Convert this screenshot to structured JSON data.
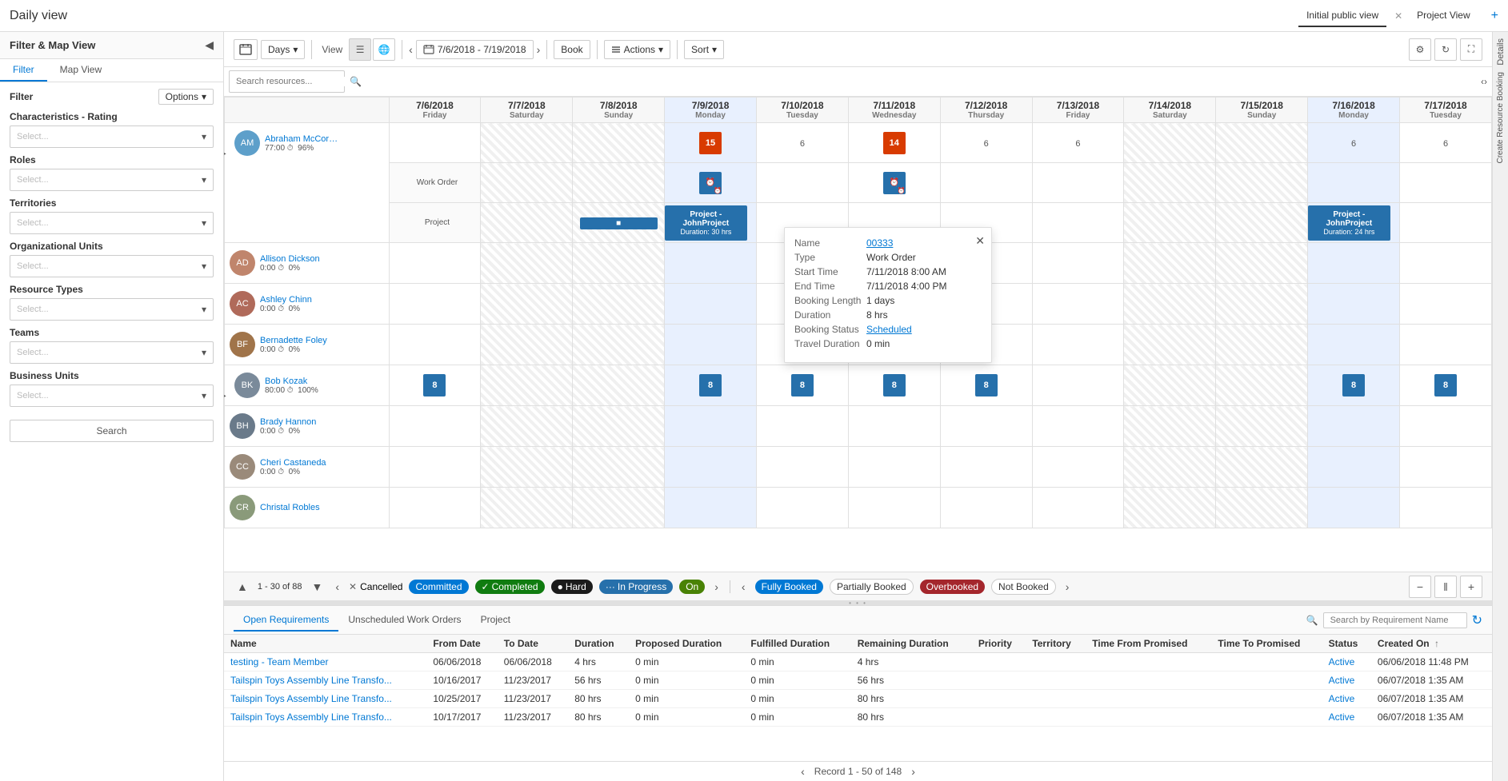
{
  "app": {
    "title": "Daily view",
    "tabs": [
      {
        "label": "Initial public view",
        "active": true
      },
      {
        "label": "Project View",
        "active": false
      }
    ]
  },
  "sidebar": {
    "title": "Filter & Map View",
    "tabs": [
      "Filter",
      "Map View"
    ],
    "active_tab": "Filter",
    "filter_label": "Filter",
    "options_btn": "Options",
    "sections": [
      {
        "label": "Characteristics - Rating"
      },
      {
        "label": "Roles"
      },
      {
        "label": "Territories"
      },
      {
        "label": "Organizational Units"
      },
      {
        "label": "Resource Types"
      },
      {
        "label": "Teams"
      },
      {
        "label": "Business Units"
      }
    ],
    "search_btn": "Search"
  },
  "toolbar": {
    "days_btn": "Days",
    "view_label": "View",
    "book_btn": "Book",
    "actions_btn": "Actions",
    "sort_btn": "Sort",
    "date_range": "7/6/2018 - 7/19/2018"
  },
  "schedule": {
    "search_placeholder": "Search resources...",
    "dates": [
      {
        "num": "7/6/2018",
        "day": "Friday"
      },
      {
        "num": "7/7/2018",
        "day": "Saturday"
      },
      {
        "num": "7/8/2018",
        "day": "Sunday"
      },
      {
        "num": "7/9/2018",
        "day": "Monday"
      },
      {
        "num": "7/10/2018",
        "day": "Tuesday"
      },
      {
        "num": "7/11/2018",
        "day": "Wednesday"
      },
      {
        "num": "7/12/2018",
        "day": "Thursday"
      },
      {
        "num": "7/13/2018",
        "day": "Friday"
      },
      {
        "num": "7/14/2018",
        "day": "Saturday"
      },
      {
        "num": "7/15/2018",
        "day": "Sunday"
      },
      {
        "num": "7/16/2018",
        "day": "Monday"
      },
      {
        "num": "7/17/2018",
        "day": "Tuesday"
      }
    ],
    "resources": [
      {
        "name": "Abraham McCormi...",
        "stats": "77:00 ⏱ 96%",
        "color": "#5d9fca",
        "initials": "AM",
        "rows": [
          "Work Order",
          "Project"
        ]
      },
      {
        "name": "Allison Dickson",
        "stats": "0:00 ⏱ 0%",
        "color": "#c0856c",
        "initials": "AD"
      },
      {
        "name": "Ashley Chinn",
        "stats": "0:00 ⏱ 0%",
        "color": "#b06a5a",
        "initials": "AC"
      },
      {
        "name": "Bernadette Foley",
        "stats": "0:00 ⏱ 0%",
        "color": "#a0744a",
        "initials": "BF"
      },
      {
        "name": "Bob Kozak",
        "stats": "80:00 ⏱ 100%",
        "color": "#7a8a9a",
        "initials": "BK"
      },
      {
        "name": "Brady Hannon",
        "stats": "0:00 ⏱ 0%",
        "color": "#6a7a8a",
        "initials": "BH"
      },
      {
        "name": "Cheri Castaneda",
        "stats": "0:00 ⏱ 0%",
        "color": "#9a8a7a",
        "initials": "CC"
      },
      {
        "name": "Christal Robles",
        "stats": "",
        "color": "#8a9a7a",
        "initials": "CR"
      }
    ]
  },
  "tooltip": {
    "name": "00333",
    "name_link": "00333",
    "type": "Work Order",
    "start_time": "7/11/2018 8:00 AM",
    "end_time": "7/11/2018 4:00 PM",
    "booking_length": "1 days",
    "duration": "8 hrs",
    "booking_status": "Scheduled",
    "travel_duration": "0 min"
  },
  "bottom_nav": {
    "page_info": "1 - 30 of 88",
    "legend": [
      {
        "label": "Cancelled",
        "type": "x"
      },
      {
        "label": "Committed",
        "type": "square",
        "color": "#0078d4"
      },
      {
        "label": "Completed",
        "type": "check",
        "color": "#107c10"
      },
      {
        "label": "Hard",
        "type": "dot",
        "color": "#1b1b1b"
      },
      {
        "label": "In Progress",
        "type": "square",
        "color": "#2670ab"
      },
      {
        "label": "On",
        "type": "square",
        "color": "#498205"
      }
    ],
    "booking_legend": [
      {
        "label": "Fully Booked",
        "color": "#0078d4"
      },
      {
        "label": "Partially Booked",
        "color": "#fff",
        "border": "#ccc"
      },
      {
        "label": "Overbooked",
        "color": "#a4262c"
      },
      {
        "label": "Not Booked",
        "color": "#fff",
        "border": "#ccc"
      }
    ]
  },
  "bottom_panel": {
    "tabs": [
      "Open Requirements",
      "Unscheduled Work Orders",
      "Project"
    ],
    "active_tab": "Open Requirements",
    "search_placeholder": "Search by Requirement Name",
    "columns": [
      "Name",
      "From Date",
      "To Date",
      "Duration",
      "Proposed Duration",
      "Fulfilled Duration",
      "Remaining Duration",
      "Priority",
      "Territory",
      "Time From Promised",
      "Time To Promised",
      "Status",
      "Created On"
    ],
    "rows": [
      {
        "name": "testing - Team Member",
        "from_date": "06/06/2018",
        "to_date": "06/06/2018",
        "duration": "4 hrs",
        "proposed": "0 min",
        "fulfilled": "0 min",
        "remaining": "4 hrs",
        "priority": "",
        "territory": "",
        "time_from": "",
        "time_to": "",
        "status": "Active",
        "created_on": "06/06/2018 11:48 PM"
      },
      {
        "name": "Tailspin Toys Assembly Line Transfo...",
        "from_date": "10/16/2017",
        "to_date": "11/23/2017",
        "duration": "56 hrs",
        "proposed": "0 min",
        "fulfilled": "0 min",
        "remaining": "56 hrs",
        "priority": "",
        "territory": "",
        "time_from": "",
        "time_to": "",
        "status": "Active",
        "created_on": "06/07/2018 1:35 AM"
      },
      {
        "name": "Tailspin Toys Assembly Line Transfo...",
        "from_date": "10/25/2017",
        "to_date": "11/23/2017",
        "duration": "80 hrs",
        "proposed": "0 min",
        "fulfilled": "0 min",
        "remaining": "80 hrs",
        "priority": "",
        "territory": "",
        "time_from": "",
        "time_to": "",
        "status": "Active",
        "created_on": "06/07/2018 1:35 AM"
      },
      {
        "name": "Tailspin Toys Assembly Line Transfo...",
        "from_date": "10/17/2017",
        "to_date": "11/23/2017",
        "duration": "80 hrs",
        "proposed": "0 min",
        "fulfilled": "0 min",
        "remaining": "80 hrs",
        "priority": "",
        "territory": "",
        "time_from": "",
        "time_to": "",
        "status": "Active",
        "created_on": "06/07/2018 1:35 AM"
      }
    ],
    "records_info": "Record 1 - 50 of 148"
  }
}
